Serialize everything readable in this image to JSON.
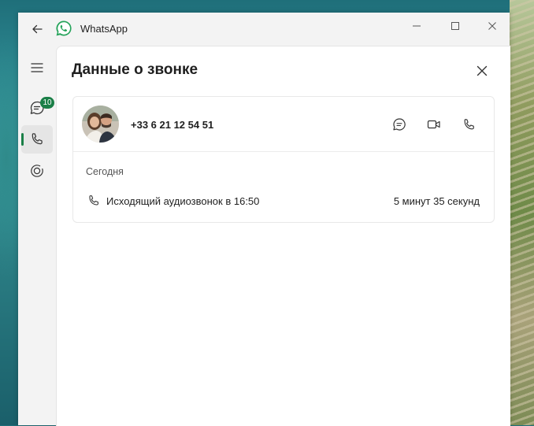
{
  "app": {
    "title": "WhatsApp"
  },
  "sidebar": {
    "chats_badge": "10"
  },
  "panel": {
    "title": "Данные о звонке"
  },
  "contact": {
    "number": "+33 6 21 12 54 51"
  },
  "call_log": {
    "day": "Сегодня",
    "entries": [
      {
        "description": "Исходящий аудиозвонок в 16:50",
        "duration": "5 минут 35 секунд"
      }
    ]
  },
  "colors": {
    "accent": "#1a7f47",
    "panel_bg": "#ffffff",
    "window_bg": "#f3f3f3"
  },
  "icons": {
    "back": "arrow-left-icon",
    "logo": "whatsapp-logo-icon",
    "minimize": "minimize-icon",
    "maximize": "maximize-icon",
    "close_window": "close-icon",
    "menu": "hamburger-menu-icon",
    "chats": "chat-bubble-icon",
    "calls": "phone-icon",
    "status": "status-ring-icon",
    "close_panel": "close-icon",
    "message": "message-icon",
    "video": "video-camera-icon",
    "voice": "phone-icon"
  }
}
